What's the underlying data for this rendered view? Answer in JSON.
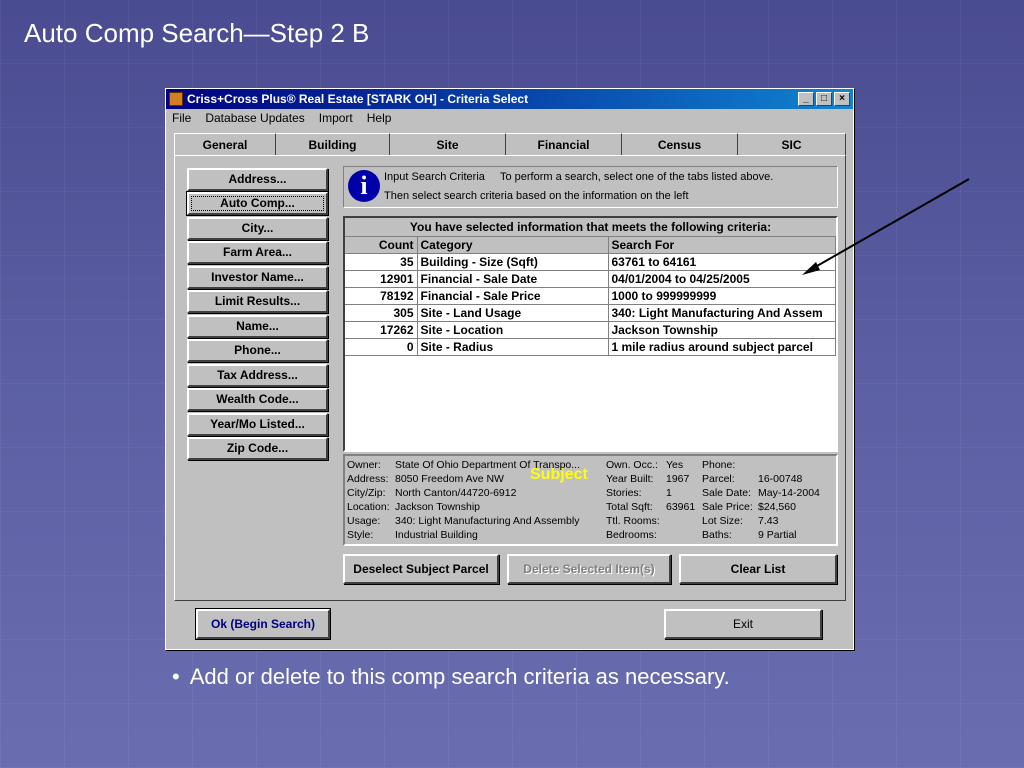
{
  "slide": {
    "title": "Auto Comp Search—Step 2 B",
    "bullet": "Add or delete to this comp search criteria as necessary."
  },
  "window": {
    "title": "Criss+Cross Plus® Real Estate [STARK OH] - Criteria Select",
    "controls": {
      "minimize": "_",
      "maximize": "□",
      "close": "×"
    },
    "menu": [
      "File",
      "Database Updates",
      "Import",
      "Help"
    ]
  },
  "tabs": [
    "General",
    "Building",
    "Site",
    "Financial",
    "Census",
    "SIC"
  ],
  "side_buttons": [
    "Address...",
    "Auto Comp...",
    "City...",
    "Farm Area...",
    "Investor Name...",
    "Limit Results...",
    "Name...",
    "Phone...",
    "Tax Address...",
    "Wealth Code...",
    "Year/Mo Listed...",
    "Zip Code..."
  ],
  "info": {
    "icon": "info-icon",
    "line1": "Input Search Criteria     To perform a search, select one of the tabs listed above.",
    "line2": "Then select search criteria based on the information on the left"
  },
  "criteria": {
    "header": "You have selected information that meets the following criteria:",
    "columns": [
      "Count",
      "Category",
      "Search For"
    ],
    "rows": [
      [
        "35",
        "Building - Size (Sqft)",
        "63761 to 64161"
      ],
      [
        "12901",
        "Financial - Sale Date",
        "04/01/2004 to 04/25/2005"
      ],
      [
        "78192",
        "Financial - Sale Price",
        "1000 to 999999999"
      ],
      [
        "305",
        "Site - Land Usage",
        "340:  Light Manufacturing And Assem"
      ],
      [
        "17262",
        "Site - Location",
        "Jackson Township"
      ],
      [
        "0",
        "Site - Radius",
        "1 mile radius around subject parcel"
      ]
    ]
  },
  "subject": {
    "label": "Subject",
    "col1": [
      [
        "Owner:",
        "State Of Ohio Department Of Transpo..."
      ],
      [
        "Address:",
        "8050 Freedom Ave NW"
      ],
      [
        "City/Zip:",
        "North Canton/44720-6912"
      ],
      [
        "Location:",
        "Jackson Township"
      ],
      [
        "Usage:",
        "340:  Light Manufacturing And Assembly"
      ],
      [
        "Style:",
        "Industrial Building"
      ]
    ],
    "col2": [
      [
        "Own. Occ.:",
        "Yes"
      ],
      [
        "Year Built:",
        "1967"
      ],
      [
        "Stories:",
        "1"
      ],
      [
        "Total Sqft:",
        "63961"
      ],
      [
        "Ttl. Rooms:",
        ""
      ],
      [
        "Bedrooms:",
        ""
      ]
    ],
    "col3": [
      [
        "Phone:",
        ""
      ],
      [
        "Parcel:",
        "16-00748"
      ],
      [
        "Sale Date:",
        "May-14-2004"
      ],
      [
        "Sale Price:",
        "$24,560"
      ],
      [
        "Lot Size:",
        "7.43"
      ],
      [
        "Baths:",
        "9 Partial"
      ]
    ]
  },
  "actions": {
    "deselect": "Deselect Subject Parcel",
    "delete": "Delete Selected Item(s)",
    "clear": "Clear List"
  },
  "footer": {
    "ok": "Ok (Begin Search)",
    "exit": "Exit"
  }
}
